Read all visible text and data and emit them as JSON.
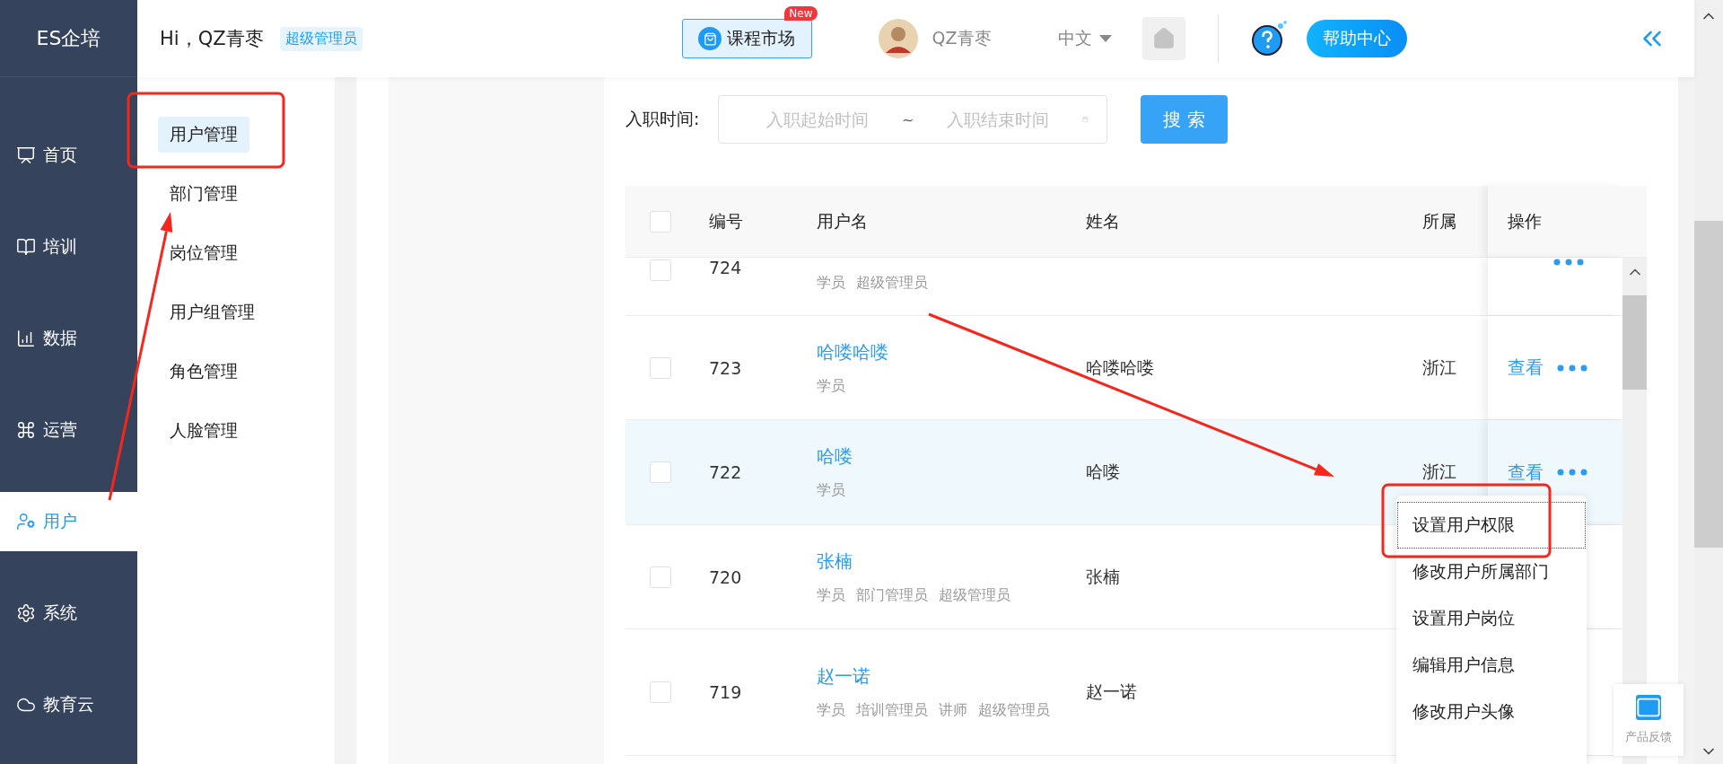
{
  "brand": "ES企培",
  "nav": [
    {
      "label": "首页",
      "selected": false
    },
    {
      "label": "培训",
      "selected": false
    },
    {
      "label": "数据",
      "selected": false
    },
    {
      "label": "运营",
      "selected": false
    },
    {
      "label": "用户",
      "selected": true
    },
    {
      "label": "系统",
      "selected": false
    },
    {
      "label": "教育云",
      "selected": false
    }
  ],
  "header": {
    "greeting": "Hi，QZ青枣",
    "role_badge": "超级管理员",
    "market": "课程市场",
    "market_badge": "New",
    "user": "QZ青枣",
    "language": "中文",
    "help": "帮助中心"
  },
  "submenu": [
    {
      "label": "用户管理",
      "selected": true
    },
    {
      "label": "部门管理",
      "selected": false
    },
    {
      "label": "岗位管理",
      "selected": false
    },
    {
      "label": "用户组管理",
      "selected": false
    },
    {
      "label": "角色管理",
      "selected": false
    },
    {
      "label": "人脸管理",
      "selected": false
    }
  ],
  "filter": {
    "label": "入职时间:",
    "start_placeholder": "入职起始时间",
    "separator": "~",
    "end_placeholder": "入职结束时间",
    "search": "搜 索"
  },
  "table": {
    "select_all_checked": false,
    "columns": [
      "编号",
      "用户名",
      "姓名",
      "所属",
      "操作"
    ],
    "rows": [
      {
        "id": "724",
        "roles": [
          "学员",
          "超级管理员"
        ],
        "checked": false,
        "highlighted": false,
        "more": true
      },
      {
        "id": "723",
        "username": "哈喽哈喽",
        "roles": [
          "学员"
        ],
        "name": "哈喽哈喽",
        "dept": "浙江",
        "view": "查看",
        "checked": false,
        "highlighted": false,
        "more": true
      },
      {
        "id": "722",
        "username": "哈喽",
        "roles": [
          "学员"
        ],
        "name": "哈喽",
        "dept": "浙江",
        "view": "查看",
        "checked": false,
        "highlighted": true,
        "more": true
      },
      {
        "id": "720",
        "username": "张楠",
        "roles": [
          "学员",
          "部门管理员",
          "超级管理员"
        ],
        "name": "张楠",
        "checked": false,
        "highlighted": false
      },
      {
        "id": "719",
        "username": "赵一诺",
        "roles": [
          "学员",
          "培训管理员",
          "讲师",
          "超级管理员"
        ],
        "name": "赵一诺",
        "checked": false,
        "highlighted": false
      }
    ]
  },
  "menu": [
    {
      "label": "设置用户权限",
      "focused": true
    },
    {
      "label": "修改用户所属部门",
      "focused": false
    },
    {
      "label": "设置用户岗位",
      "focused": false
    },
    {
      "label": "编辑用户信息",
      "focused": false
    },
    {
      "label": "修改用户头像",
      "focused": false
    }
  ],
  "feedback": "产品反馈",
  "annotations": [
    {
      "kind": "box"
    },
    {
      "kind": "arrow"
    },
    {
      "kind": "arrow"
    },
    {
      "kind": "box"
    }
  ]
}
